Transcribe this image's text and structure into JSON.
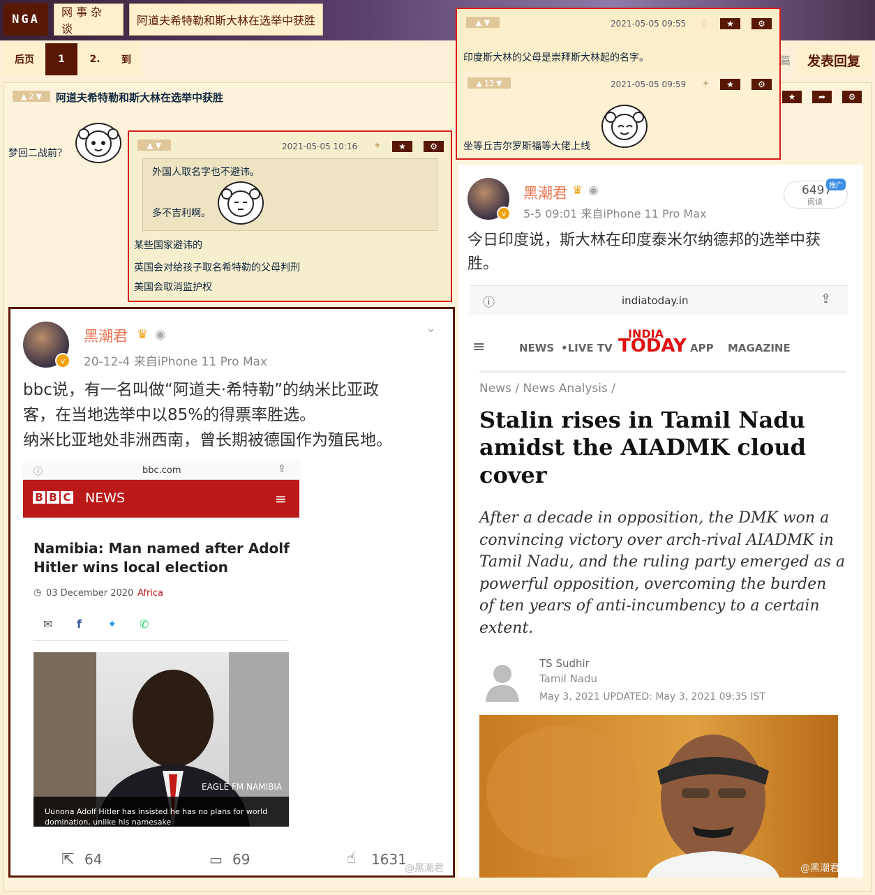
{
  "nav": {
    "logo": "NGA",
    "breadcrumb": [
      "网 事 杂 谈",
      "阿道夫希特勒和斯大林在选举中获胜"
    ],
    "pager": {
      "prev": "后页",
      "current": "1",
      "next": "2.",
      "goto": "到"
    },
    "reply_button": "发表回复",
    "reply_partial": "篇"
  },
  "post": {
    "like_count": "2",
    "title": "阿道夫希特勒和斯大林在选举中获胜",
    "main_text": "梦回二战前？"
  },
  "reply_left": {
    "date": "2021-05-05 10:16",
    "quote_line1": "外国人取名字也不避讳。",
    "quote_line2": "多不吉利啊。",
    "lines": [
      "某些国家避讳的",
      "英国会对给孩子取名希特勒的父母判刑",
      "美国会取消监护权"
    ]
  },
  "reply_right": {
    "first_date": "2021-05-05 09:55",
    "first_text": "印度斯大林的父母是崇拜斯大林起的名字。",
    "second_like": "13",
    "second_date": "2021-05-05 09:59",
    "second_text": "坐等丘吉尔罗斯福等大佬上线"
  },
  "weibo_left": {
    "name": "黑潮君",
    "meta": "20-12-4  来自iPhone 11 Pro Max",
    "text": [
      "bbc说，有一名叫做“阿道夫·希特勒”的纳米比亚政",
      "客，在当地选举中以85%的得票率胜选。",
      "纳米比亚地处非洲西南，曾长期被德国作为殖民地。"
    ],
    "domain": "bbc.com",
    "bbc_logo": "BBC",
    "bbc_news": "NEWS",
    "headline": [
      "Namibia: Man named after Adolf",
      "Hitler wins local election"
    ],
    "article_date": "03 December 2020",
    "section": "Africa",
    "photo_credit": "EAGLE FM NAMIBIA",
    "caption": [
      "Uunona Adolf Hitler has insisted he has no plans for world",
      "domination, unlike his namesake"
    ],
    "reposts": "64",
    "comments": "69",
    "likes": "1631",
    "watermark": "@黑潮君"
  },
  "weibo_right": {
    "name": "黑潮君",
    "meta": "5-5 09:01  来自iPhone 11 Pro Max",
    "views": "6497",
    "views_label": "阅读",
    "promo": "推广",
    "text": [
      "今日印度说，斯大林在印度泰米尔纳德邦的选举中获",
      "胜。"
    ],
    "domain": "indiatoday.in",
    "menu": [
      "NEWS",
      "•LIVE TV",
      "INDIA",
      "TODAY",
      "APP",
      "MAGAZINE"
    ],
    "breadcrumb": "News / News Analysis /",
    "headline": [
      "Stalin rises in Tamil Nadu",
      "amidst the AIADMK cloud",
      "cover"
    ],
    "summary": [
      "After a decade in opposition, the DMK won a",
      "convincing victory over arch-rival AIADMK in",
      "Tamil Nadu, and the ruling party emerged as a",
      "powerful opposition, overcoming the burden",
      "of ten years of anti-incumbency to a certain",
      "extent."
    ],
    "author": "TS Sudhir",
    "location": "Tamil Nadu",
    "dates": "May 3, 2021  UPDATED: May 3, 2021 09:35 IST",
    "watermark": "@黑潮君"
  },
  "colors": {
    "brand": "#591804",
    "highlight": "#d81b1b",
    "weibo_name": "#eb7350",
    "bbc_red": "#bb1919"
  }
}
